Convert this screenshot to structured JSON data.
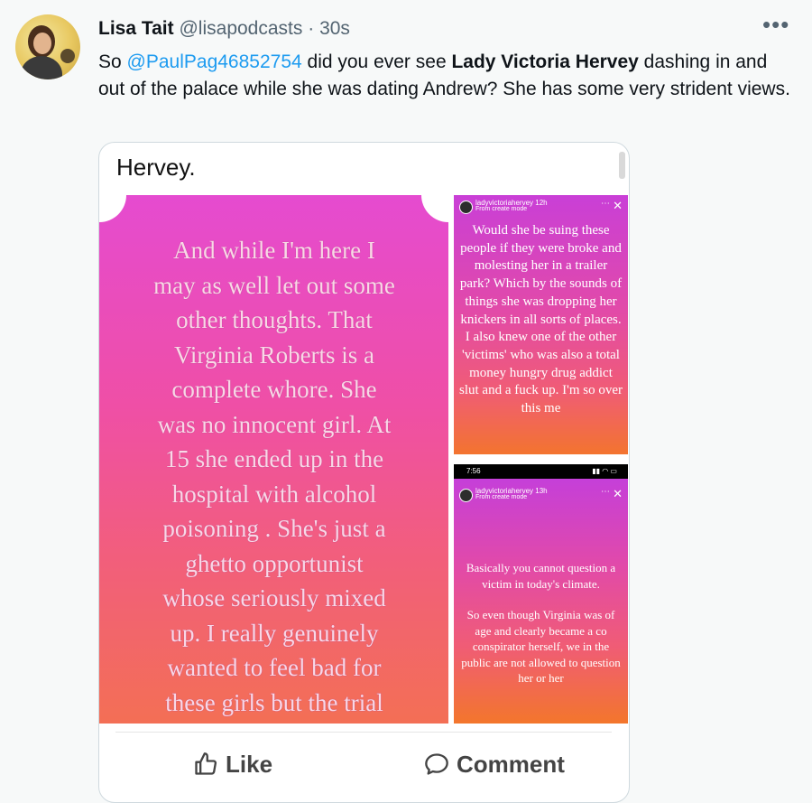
{
  "tweet": {
    "author_name": "Lisa Tait",
    "author_handle": "@lisapodcasts",
    "separator": "·",
    "time": "30s",
    "text_prefix": "So ",
    "mention": "@PaulPag46852754",
    "text_mid": " did you ever see ",
    "bold_name": "Lady Victoria Hervey",
    "text_suffix": " dashing in and out of the palace while she was dating Andrew? She has some very strident views.",
    "more_icon": "more-horizontal-icon"
  },
  "card": {
    "title": "Hervey.",
    "main_image_text": "And while I'm here I\nmay as well let out some\nother thoughts. That\nVirginia Roberts is a\ncomplete whore. She\nwas no innocent girl. At\n15 she ended up in the\nhospital with alcohol\npoisoning . She's just a\nghetto opportunist\nwhose seriously mixed\nup. I really genuinely\nwanted to feel bad for\nthese girls but the trial",
    "story1": {
      "username": "ladyvictoriahervey",
      "age": "12h",
      "subtitle": "From create mode",
      "text": "Would she be suing these people if they were broke and molesting her in a trailer park? Which by the sounds of things she was dropping her knickers in all sorts of places. I also knew one of the other 'victims' who was also a total money hungry drug addict slut and a fuck up. I'm so over this me"
    },
    "story2": {
      "status_time": "7:56",
      "username": "ladyvictoriahervey",
      "age": "13h",
      "subtitle": "From create mode",
      "text_p1": "Basically you cannot question a victim in today's climate.",
      "text_p2": "So even though Virginia was of age and clearly became a co conspirator herself, we in the public are not allowed to question her or her"
    },
    "actions": {
      "like_label": "Like",
      "comment_label": "Comment"
    }
  }
}
